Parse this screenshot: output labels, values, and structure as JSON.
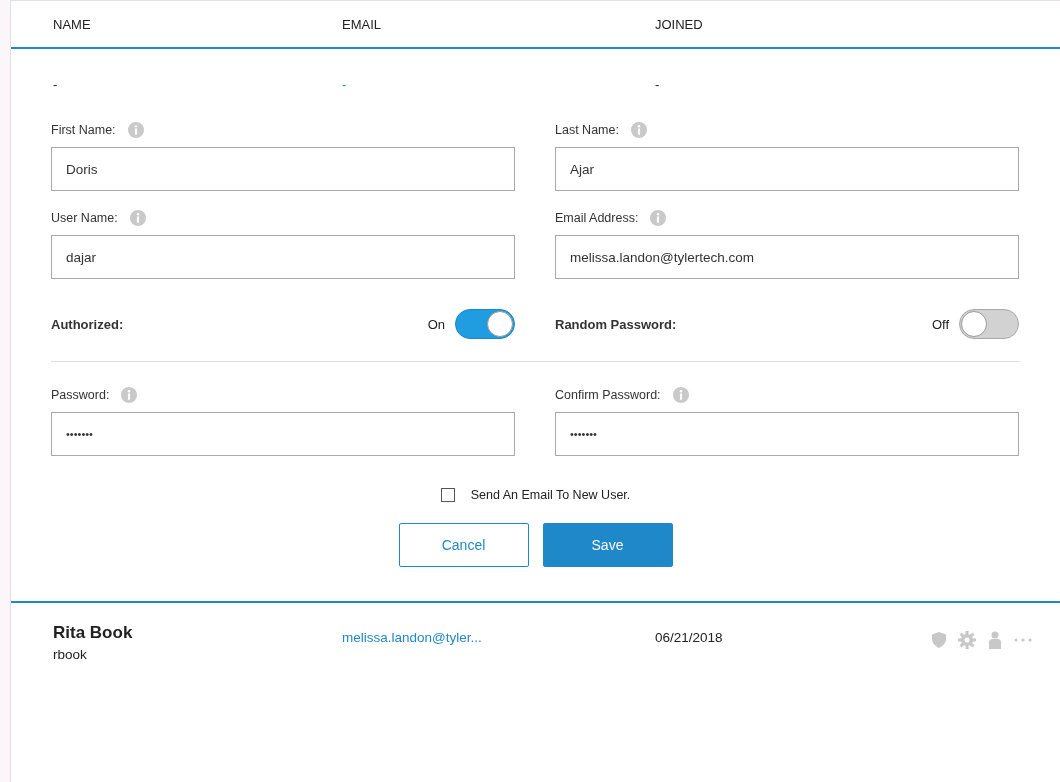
{
  "table": {
    "columns": [
      "NAME",
      "EMAIL",
      "JOINED"
    ],
    "edit_row": {
      "name": "-",
      "email": "-",
      "joined": "-"
    }
  },
  "form": {
    "fields": [
      {
        "label": "First Name:",
        "value": "Doris"
      },
      {
        "label": "Last Name:",
        "value": "Ajar"
      },
      {
        "label": "User Name:",
        "value": "dajar"
      },
      {
        "label": "Email Address:",
        "value": "melissa.landon@tylertech.com"
      }
    ],
    "toggles": [
      {
        "label": "Authorized:",
        "state_text": "On",
        "on": true
      },
      {
        "label": "Random Password:",
        "state_text": "Off",
        "on": false
      }
    ],
    "passwords": [
      {
        "label": "Password:",
        "value": "•••••••"
      },
      {
        "label": "Confirm Password:",
        "value": "•••••••"
      }
    ],
    "send_email": {
      "label": "Send An Email To New User.",
      "checked": false
    },
    "buttons": [
      {
        "label": "Cancel",
        "kind": "secondary"
      },
      {
        "label": "Save",
        "kind": "primary"
      }
    ]
  },
  "users": [
    {
      "name": "Rita Book",
      "username": "rbook",
      "email": "melissa.landon@tyler...",
      "joined": "06/21/2018"
    }
  ]
}
